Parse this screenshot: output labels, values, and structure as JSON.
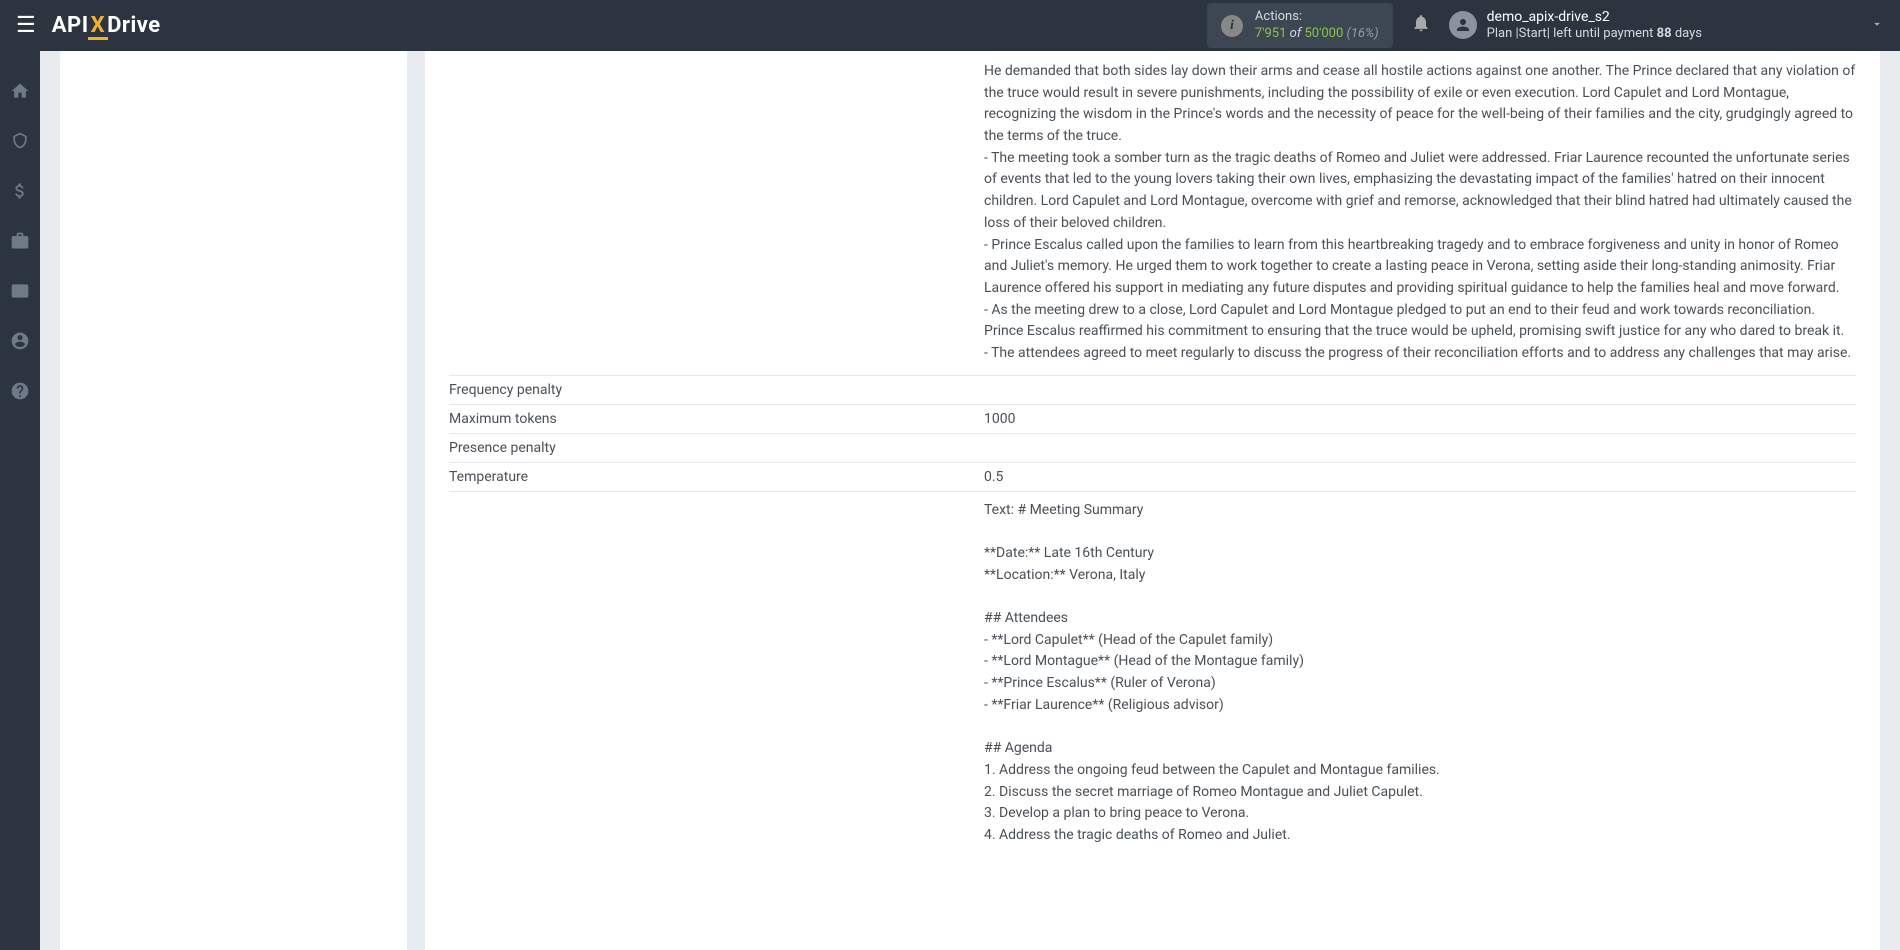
{
  "header": {
    "logo": {
      "api": "API",
      "x": "X",
      "drive": "Drive"
    },
    "actions": {
      "label": "Actions:",
      "used": "7'951",
      "of": "of",
      "total": "50'000",
      "percent": "(16%)"
    },
    "user": {
      "name": "demo_apix-drive_s2",
      "plan_prefix": "Plan |",
      "plan_name": "Start",
      "plan_suffix": "| left until payment",
      "days": "88",
      "days_label": "days"
    }
  },
  "content": {
    "paragraphs": [
      "He demanded that both sides lay down their arms and cease all hostile actions against one another. The Prince declared that any violation of the truce would result in severe punishments, including the possibility of exile or even execution. Lord Capulet and Lord Montague, recognizing the wisdom in the Prince's words and the necessity of peace for the well-being of their families and the city, grudgingly agreed to the terms of the truce.",
      "- The meeting took a somber turn as the tragic deaths of Romeo and Juliet were addressed. Friar Laurence recounted the unfortunate series of events that led to the young lovers taking their own lives, emphasizing the devastating impact of the families' hatred on their innocent children. Lord Capulet and Lord Montague, overcome with grief and remorse, acknowledged that their blind hatred had ultimately caused the loss of their beloved children.",
      "- Prince Escalus called upon the families to learn from this heartbreaking tragedy and to embrace forgiveness and unity in honor of Romeo and Juliet's memory. He urged them to work together to create a lasting peace in Verona, setting aside their long-standing animosity. Friar Laurence offered his support in mediating any future disputes and providing spiritual guidance to help the families heal and move forward.",
      "- As the meeting drew to a close, Lord Capulet and Lord Montague pledged to put an end to their feud and work towards reconciliation. Prince Escalus reaffirmed his commitment to ensuring that the truce would be upheld, promising swift justice for any who dared to break it.",
      "- The attendees agreed to meet regularly to discuss the progress of their reconciliation efforts and to address any challenges that may arise."
    ],
    "params": {
      "freq_penalty_label": "Frequency penalty",
      "freq_penalty_value": "",
      "max_tokens_label": "Maximum tokens",
      "max_tokens_value": "1000",
      "presence_penalty_label": "Presence penalty",
      "presence_penalty_value": "",
      "temperature_label": "Temperature",
      "temperature_value": "0.5"
    },
    "output": "Text: # Meeting Summary\n\n**Date:** Late 16th Century\n**Location:** Verona, Italy\n\n## Attendees\n- **Lord Capulet** (Head of the Capulet family)\n- **Lord Montague** (Head of the Montague family)\n- **Prince Escalus** (Ruler of Verona)\n- **Friar Laurence** (Religious advisor)\n\n## Agenda\n1. Address the ongoing feud between the Capulet and Montague families.\n2. Discuss the secret marriage of Romeo Montague and Juliet Capulet.\n3. Develop a plan to bring peace to Verona.\n4. Address the tragic deaths of Romeo and Juliet."
  }
}
